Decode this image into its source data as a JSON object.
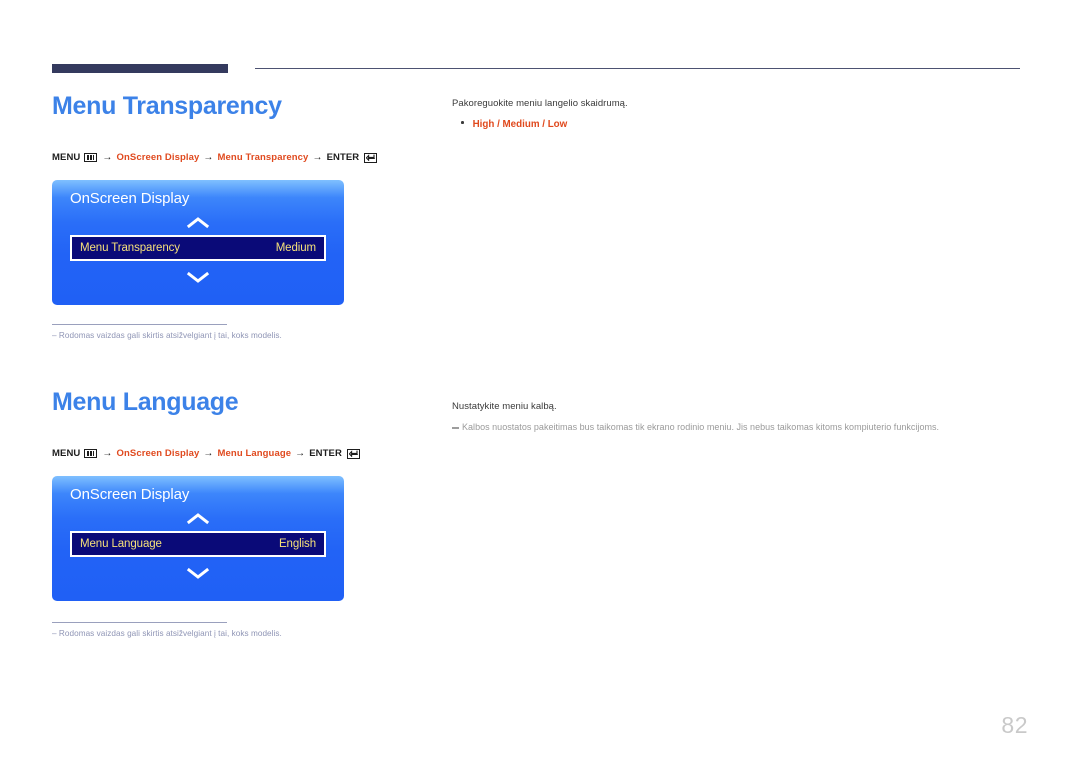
{
  "page": {
    "number": "82"
  },
  "sections": [
    {
      "title": "Menu Transparency",
      "breadcrumb": {
        "menu_label": "MENU",
        "menu_icon": "menu-grid-icon",
        "arrow": "→",
        "path1": "OnScreen Display",
        "path2": "Menu Transparency",
        "enter_label": "ENTER",
        "enter_icon": "enter-return-icon"
      },
      "osd": {
        "title": "OnScreen Display",
        "up_icon": "chevron-up-icon",
        "down_icon": "chevron-down-icon",
        "row_label": "Menu Transparency",
        "row_value": "Medium"
      },
      "footnote": "‒ Rodomas vaizdas gali skirtis atsižvelgiant į tai, koks modelis.",
      "right": {
        "lead": "Pakoreguokite meniu langelio skaidrumą.",
        "bullet_options": "High / Medium / Low"
      }
    },
    {
      "title": "Menu Language",
      "breadcrumb": {
        "menu_label": "MENU",
        "menu_icon": "menu-grid-icon",
        "arrow": "→",
        "path1": "OnScreen Display",
        "path2": "Menu Language",
        "enter_label": "ENTER",
        "enter_icon": "enter-return-icon"
      },
      "osd": {
        "title": "OnScreen Display",
        "up_icon": "chevron-up-icon",
        "down_icon": "chevron-down-icon",
        "row_label": "Menu Language",
        "row_value": "English"
      },
      "footnote": "‒ Rodomas vaizdas gali skirtis atsižvelgiant į tai, koks modelis.",
      "right": {
        "lead": "Nustatykite meniu kalbą.",
        "note": "Kalbos nuostatos pakeitimas bus taikomas tik ekrano rodinio meniu. Jis nebus taikomas kitoms kompiuterio funkcijoms."
      }
    }
  ],
  "colors": {
    "heading": "#3c82e8",
    "accent_orange": "#e0491d",
    "rule_dark": "#343a5e",
    "osd_blue": "#2060f5",
    "osd_row_bg": "#0a0a78",
    "osd_row_text": "#f5e07a",
    "footnote_gray": "#8f95b5"
  }
}
